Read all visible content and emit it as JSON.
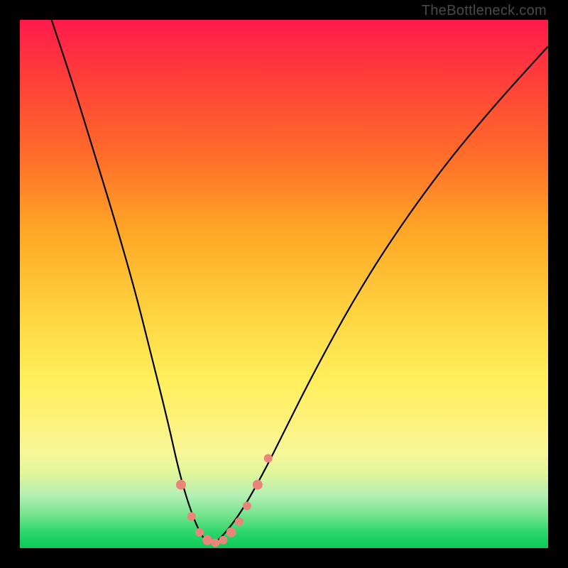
{
  "watermark": "TheBottleneck.com",
  "colors": {
    "frame": "#000000",
    "curve_stroke": "#000000",
    "marker_fill": "#e8867a",
    "gradient_top": "#ff1a4d",
    "gradient_bottom": "#0cc95a"
  },
  "chart_data": {
    "type": "line",
    "title": "",
    "xlabel": "",
    "ylabel": "",
    "xlim": [
      0,
      100
    ],
    "ylim": [
      0,
      100
    ],
    "note": "Axes are unlabeled; x is an abstract horizontal position 0–100, y is bottleneck severity 0 (green/good) to 100 (red/bad). Values are read from pixel positions.",
    "series": [
      {
        "name": "bottleneck-curve",
        "x": [
          6,
          10,
          14,
          18,
          22,
          25,
          28,
          30,
          32,
          34,
          35.5,
          37,
          39,
          42,
          46,
          50,
          55,
          62,
          70,
          80,
          90,
          100
        ],
        "y": [
          100,
          88,
          75,
          62,
          48,
          36,
          24,
          15,
          8,
          3,
          1,
          1,
          3,
          7,
          14,
          22,
          32,
          45,
          58,
          72,
          84,
          95
        ]
      }
    ],
    "markers": {
      "name": "highlighted-points",
      "x": [
        30.5,
        32.5,
        34,
        35.5,
        37,
        38.5,
        40,
        41.5,
        43,
        45,
        47
      ],
      "y": [
        12,
        6,
        3,
        1.5,
        1,
        1.5,
        3,
        5,
        8,
        12,
        17
      ]
    }
  }
}
